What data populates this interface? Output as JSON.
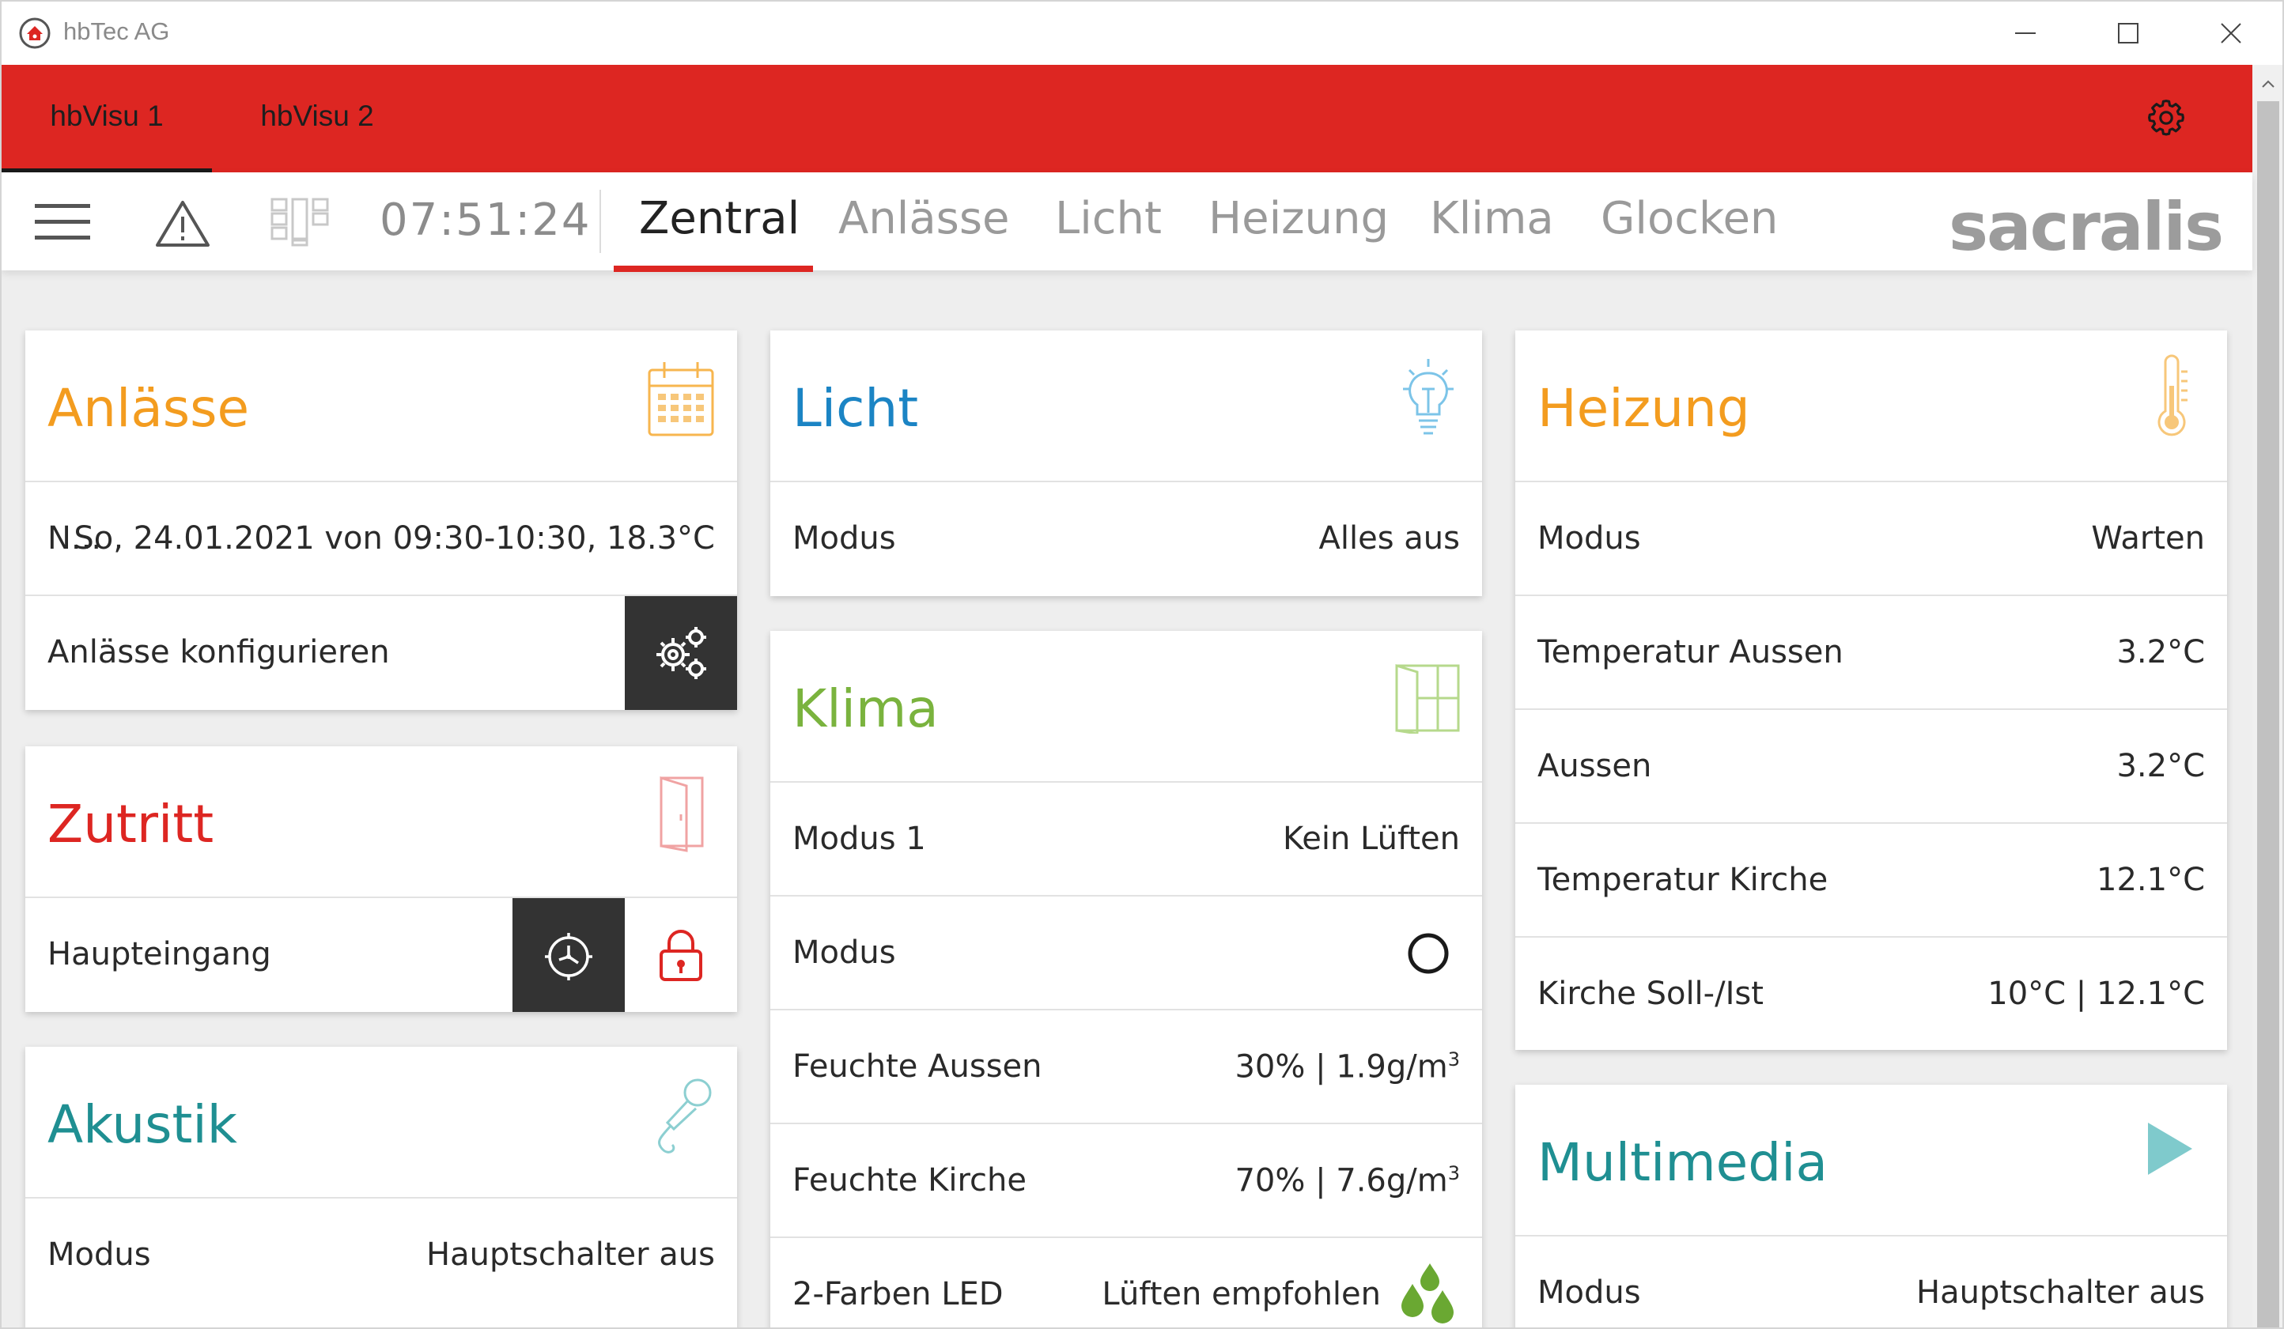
{
  "window": {
    "title": "hbTec AG"
  },
  "app_tabs": [
    {
      "label": "hbVisu 1",
      "active": true
    },
    {
      "label": "hbVisu 2",
      "active": false
    }
  ],
  "nav": {
    "clock": "07:51:24",
    "tabs": [
      {
        "label": "Zentral",
        "active": true
      },
      {
        "label": "Anlässe",
        "active": false
      },
      {
        "label": "Licht",
        "active": false
      },
      {
        "label": "Heizung",
        "active": false
      },
      {
        "label": "Klima",
        "active": false
      },
      {
        "label": "Glocken",
        "active": false
      }
    ],
    "brand": "sacralis"
  },
  "cards": {
    "anlaesse": {
      "title": "Anlässe",
      "title_color": "#f39c1f",
      "icon": "calendar-icon",
      "event_prefix": "N...",
      "event_text": "So, 24.01.2021 von 09:30-10:30, 18.3°C",
      "config_label": "Anlässe konfigurieren"
    },
    "zutritt": {
      "title": "Zutritt",
      "title_color": "#dd2622",
      "icon": "door-icon",
      "row_label": "Haupteingang"
    },
    "akustik": {
      "title": "Akustik",
      "title_color": "#1f8f92",
      "icon": "microphone-icon",
      "row_label": "Modus",
      "row_value": "Hauptschalter aus"
    },
    "licht": {
      "title": "Licht",
      "title_color": "#1b84c4",
      "icon": "lightbulb-icon",
      "row_label": "Modus",
      "row_value": "Alles aus"
    },
    "klima": {
      "title": "Klima",
      "title_color": "#7ab33e",
      "icon": "window-icon",
      "rows": [
        {
          "label": "Modus 1",
          "value": "Kein Lüften"
        },
        {
          "label": "Modus",
          "value": ""
        },
        {
          "label": "Feuchte Aussen",
          "value": "30% | 1.9g/m",
          "sup": "3"
        },
        {
          "label": "Feuchte Kirche",
          "value": "70% | 7.6g/m",
          "sup": "3"
        },
        {
          "label": "2-Farben LED",
          "value": "Lüften empfohlen"
        }
      ]
    },
    "heizung": {
      "title": "Heizung",
      "title_color": "#f39c1f",
      "icon": "thermometer-icon",
      "rows": [
        {
          "label": "Modus",
          "value": "Warten"
        },
        {
          "label": "Temperatur Aussen",
          "value": "3.2°C"
        },
        {
          "label": "Aussen",
          "value": "3.2°C"
        },
        {
          "label": "Temperatur Kirche",
          "value": "12.1°C"
        },
        {
          "label": "Kirche Soll-/Ist",
          "value": "10°C | 12.1°C"
        }
      ]
    },
    "multimedia": {
      "title": "Multimedia",
      "title_color": "#1f8f92",
      "icon": "play-icon",
      "row_label": "Modus",
      "row_value": "Hauptschalter aus"
    }
  }
}
